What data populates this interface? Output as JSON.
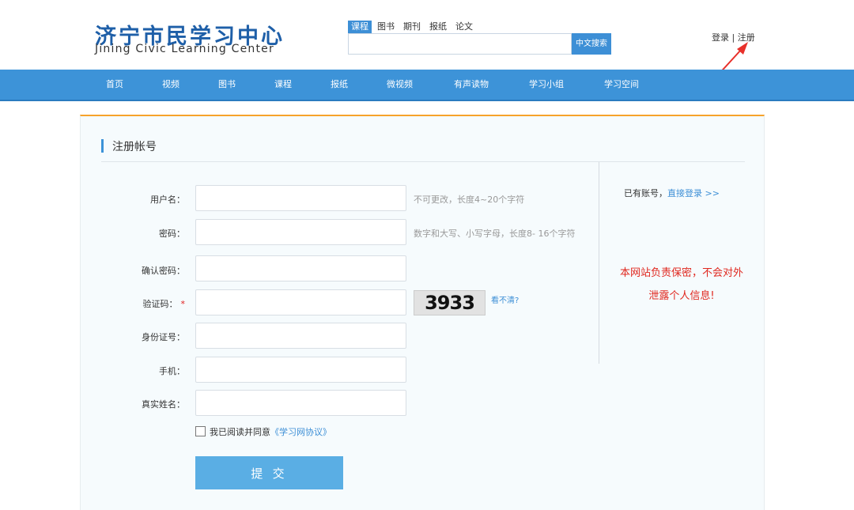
{
  "header": {
    "logo_cn": "济宁市民学习中心",
    "logo_en": "Jining Civic Learning Center",
    "search": {
      "tabs": [
        "课程",
        "图书",
        "期刊",
        "报纸",
        "论文"
      ],
      "active_tab": "课程",
      "value": "",
      "button": "中文搜索"
    },
    "user_links": {
      "login": "登录",
      "sep": " | ",
      "register": "注册"
    }
  },
  "nav": {
    "items": [
      "首页",
      "视频",
      "图书",
      "课程",
      "报纸",
      "微视频",
      "有声读物",
      "学习小组",
      "学习空间"
    ]
  },
  "form": {
    "title": "注册帐号",
    "fields": [
      {
        "label": "用户名：",
        "value": "",
        "hint": "不可更改，长度4~20个字符"
      },
      {
        "label": "密码：",
        "value": "",
        "hint": "数字和大写、小写字母，长度8- 16个字符"
      },
      {
        "label": "确认密码：",
        "value": "",
        "hint": ""
      },
      {
        "label": "验证码：",
        "value": "",
        "required_mark": "*"
      },
      {
        "label": "身份证号：",
        "value": ""
      },
      {
        "label": "手机：",
        "value": ""
      },
      {
        "label": "真实姓名：",
        "value": ""
      }
    ],
    "captcha_text": "3933",
    "captcha_refresh": "看不清?",
    "agree_text": "我已阅读并同意",
    "agree_link": "《学习网协议》",
    "submit": "提 交"
  },
  "side": {
    "account_text": "已有账号，",
    "login_link": "直接登录 >>",
    "privacy_line1": "本网站负责保密，不会对外",
    "privacy_line2": "泄露个人信息!"
  },
  "colors": {
    "brand": "#3d93d8",
    "accent_line": "#f6a32b",
    "warning": "#e0281f",
    "annotation_arrow": "#e8302a"
  }
}
